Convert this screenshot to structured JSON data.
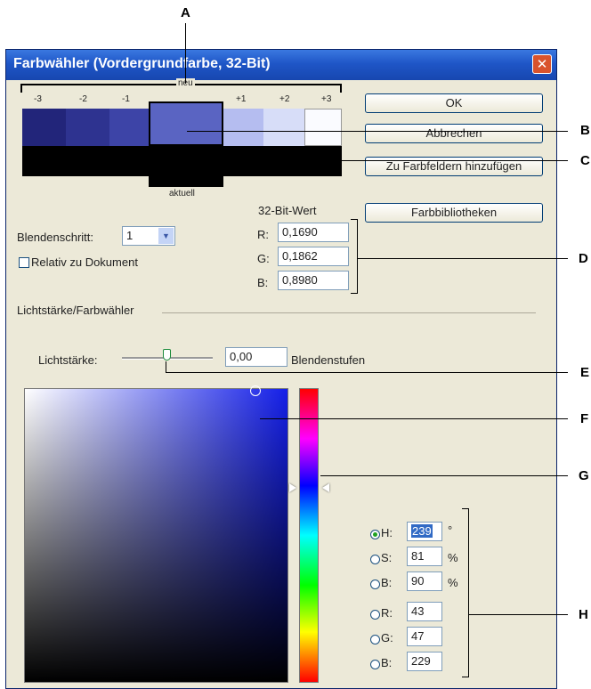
{
  "callouts": {
    "a": "A",
    "b": "B",
    "c": "C",
    "d": "D",
    "e": "E",
    "f": "F",
    "g": "G",
    "h": "H"
  },
  "window": {
    "title": "Farbwähler (Vordergrundfarbe, 32-Bit)"
  },
  "preview": {
    "neu_label": "neu",
    "aktuell_label": "aktuell",
    "steps": [
      "-3",
      "-2",
      "-1",
      "+1",
      "+2",
      "+3"
    ],
    "colors": [
      "#22257a",
      "#2e3390",
      "#3d44a7",
      "#6b75cf",
      "#b5bdf0",
      "#d7ddf8",
      "#fafbff"
    ],
    "new_color": "#5a64c2"
  },
  "buttons": {
    "ok": "OK",
    "cancel": "Abbrechen",
    "add_swatches": "Zu Farbfeldern hinzufügen",
    "libraries": "Farbbibliotheken"
  },
  "exposure": {
    "label": "Blendenschritt:",
    "value": "1"
  },
  "relative": {
    "label": "Relativ zu Dokument",
    "checked": false
  },
  "bit_values": {
    "heading": "32-Bit-Wert",
    "r_label": "R:",
    "r": "0,1690",
    "g_label": "G:",
    "g": "0,1862",
    "b_label": "B:",
    "b": "0,8980"
  },
  "section_label": "Lichtstärke/Farbwähler",
  "intensity": {
    "label": "Lichtstärke:",
    "value": "0,00",
    "unit": "Blendenstufen"
  },
  "hsb_rgb": {
    "h_label": "H:",
    "h": "239",
    "h_unit": "°",
    "s_label": "S:",
    "s": "81",
    "s_unit": "%",
    "b_label": "B:",
    "b": "90",
    "b_unit": "%",
    "r_label": "R:",
    "r": "43",
    "g_label": "G:",
    "g": "47",
    "bb_label": "B:",
    "bb": "229"
  }
}
